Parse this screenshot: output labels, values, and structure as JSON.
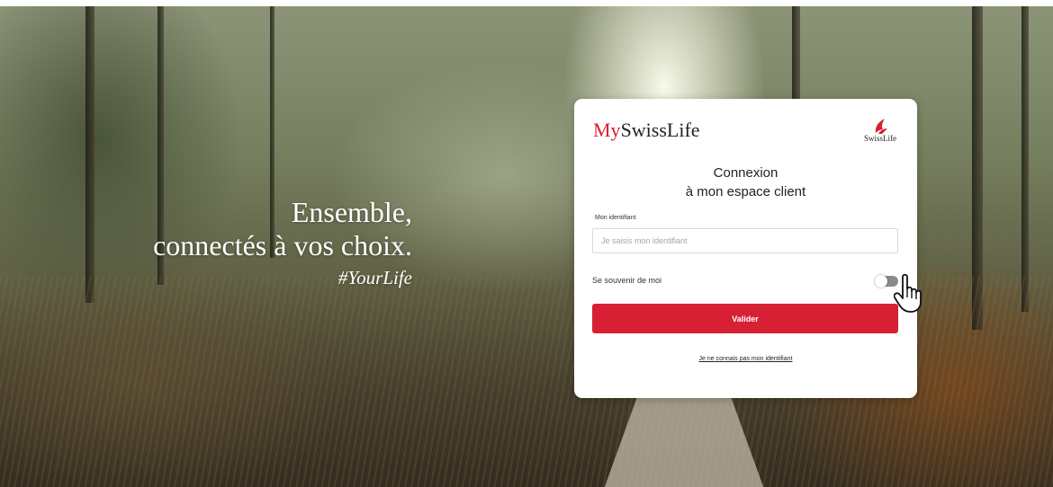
{
  "hero": {
    "line1": "Ensemble,",
    "line2": "connectés à vos choix.",
    "tagline": "#YourLife"
  },
  "card": {
    "brand_my": "My",
    "brand_rest": "SwissLife",
    "logo_text": "SwissLife",
    "heading_line1": "Connexion",
    "heading_line2": "à mon espace client",
    "identifier_label": "Mon identifiant",
    "identifier_value": "",
    "identifier_placeholder": "Je saisis mon identifiant",
    "remember_label": "Se souvenir de moi",
    "remember_checked": false,
    "submit_label": "Valider",
    "forgot_link": "Je ne connais pas mon identifiant"
  },
  "icons": {
    "logo": "swisslife-logo-icon",
    "cursor": "hand-pointer-icon"
  },
  "colors": {
    "brand_red": "#d82034",
    "text": "#222222",
    "toggle_off": "#8a8a8a",
    "card_bg": "#ffffff"
  }
}
